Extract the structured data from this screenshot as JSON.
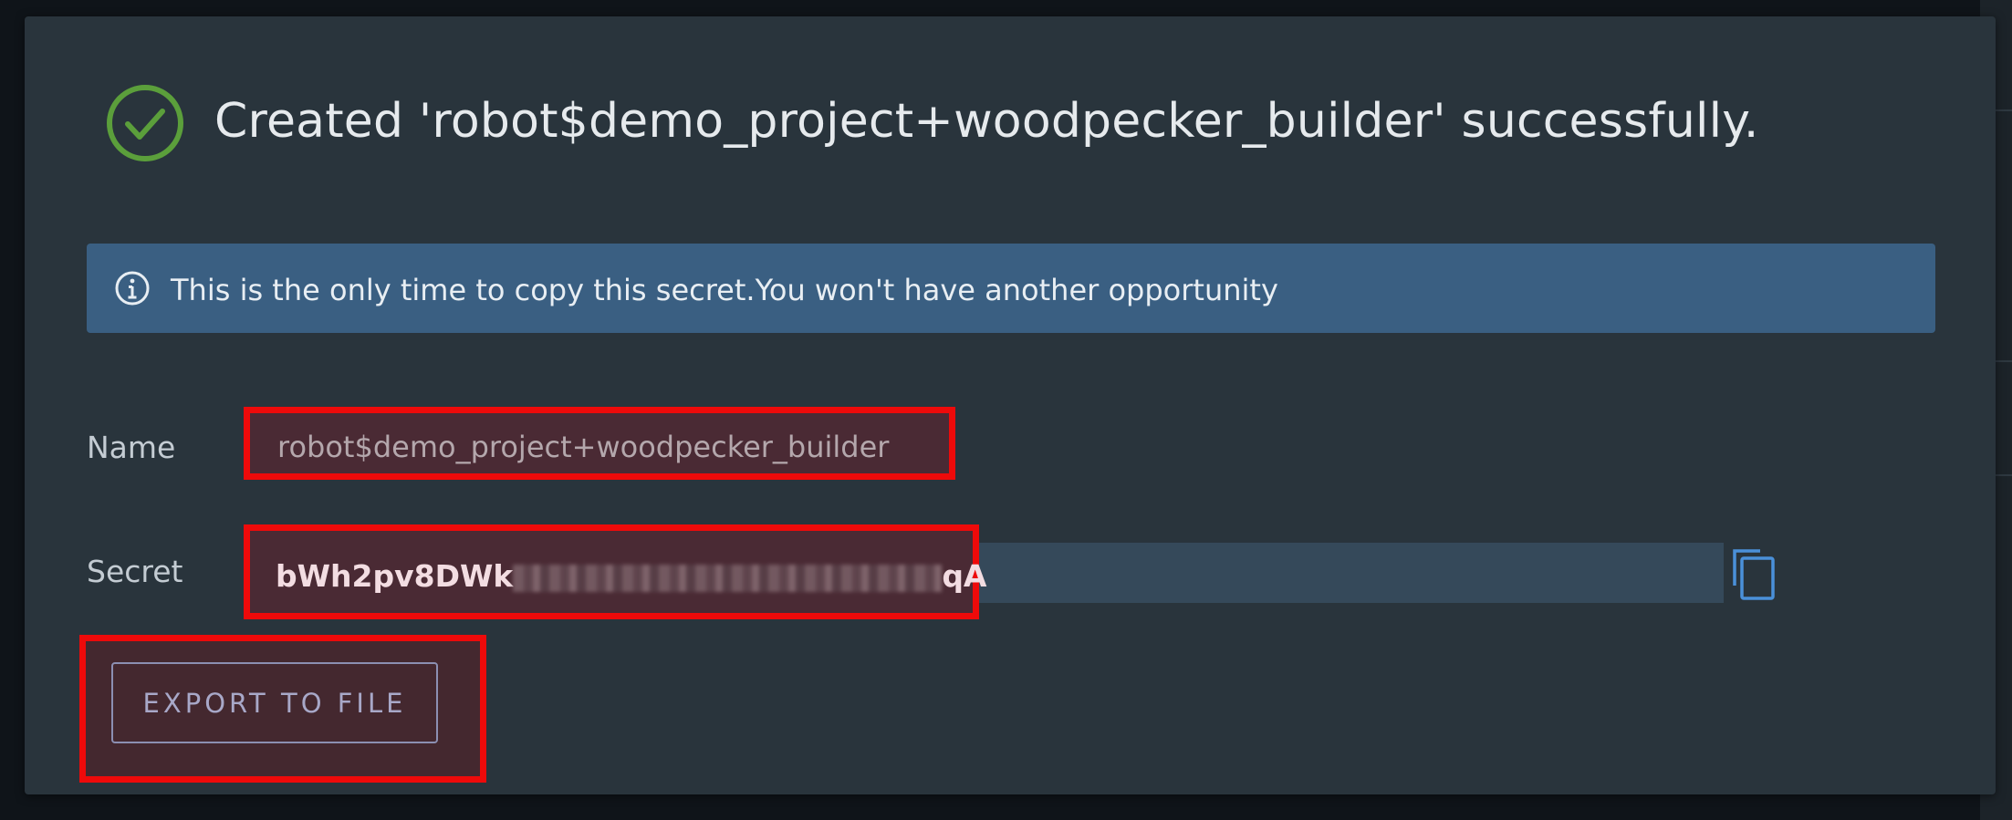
{
  "dialog": {
    "title": "Created 'robot$demo_project+woodpecker_builder' successfully.",
    "status_icon": "check-circle-icon",
    "alert": {
      "icon": "info-icon",
      "text": "This is the only time to copy this secret.You won't have another opportunity"
    },
    "name": {
      "label": "Name",
      "value": "robot$demo_project+woodpecker_builder"
    },
    "secret": {
      "label": "Secret",
      "value_start": "bWh2pv8DWk",
      "value_end": "qA",
      "copy_icon": "copy-icon"
    },
    "export_button_label": "EXPORT TO FILE"
  },
  "colors": {
    "success": "#5b9f3b",
    "alert_background": "#3a5f82",
    "highlight_border": "#ee0a0a",
    "copy_icon": "#4a90d9"
  }
}
